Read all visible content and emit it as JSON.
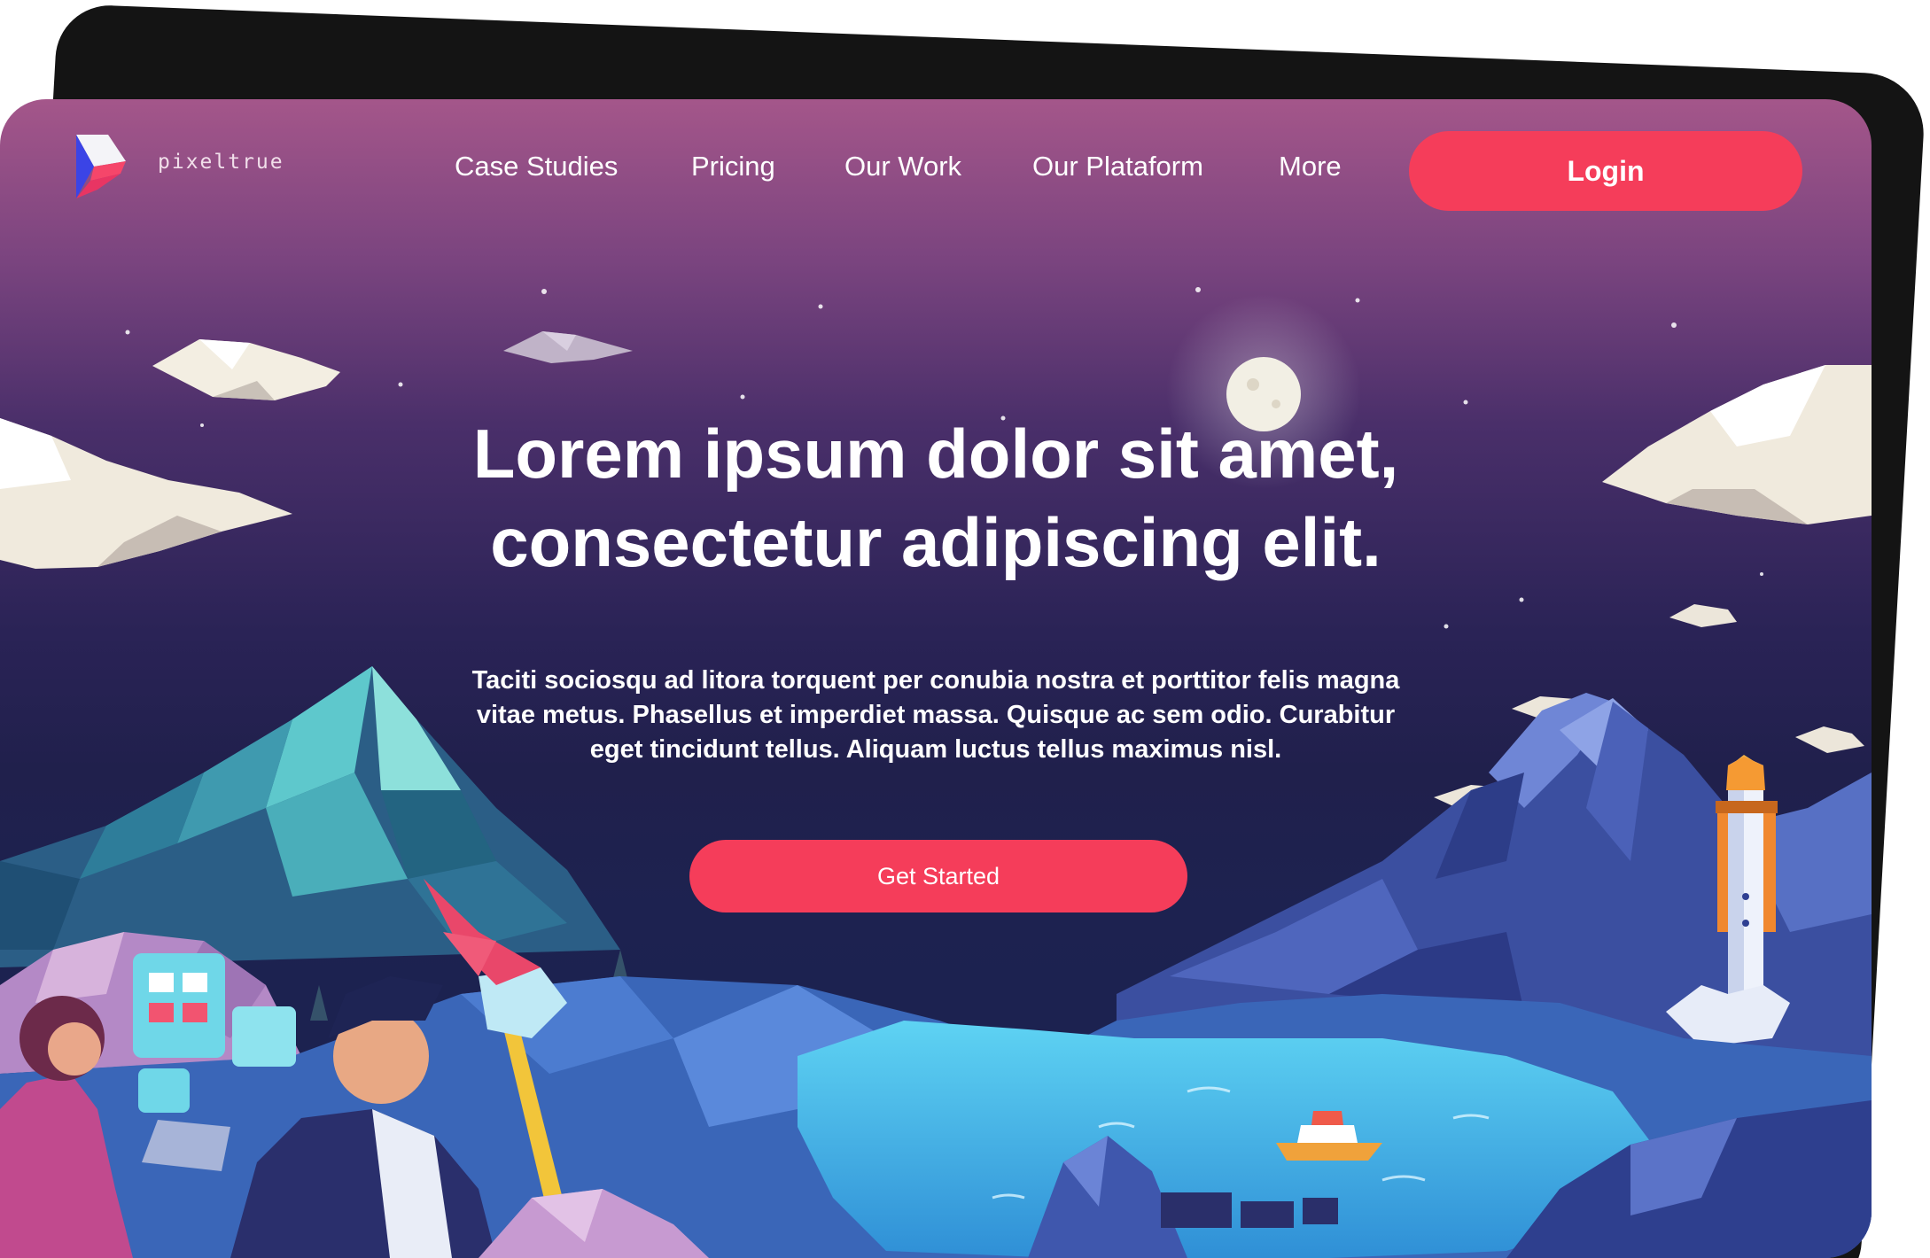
{
  "brand": {
    "name": "pixeltrue"
  },
  "nav": {
    "links": [
      "Case Studies",
      "Pricing",
      "Our Work",
      "Our Plataform",
      "More"
    ],
    "login_label": "Login"
  },
  "hero": {
    "title_line1": "Lorem ipsum dolor sit amet,",
    "title_line2": "consectetur adipiscing elit.",
    "desc_line1": "Taciti sociosqu ad litora torquent per conubia nostra et porttitor felis magna",
    "desc_line2": "vitae metus. Phasellus et imperdiet massa. Quisque ac sem odio. Curabitur",
    "desc_line3": "eget tincidunt tellus. Aliquam luctus tellus maximus nisl.",
    "cta_label": "Get Started"
  },
  "colors": {
    "accent": "#f53d5a",
    "sky_top": "#a4568a",
    "sky_bottom": "#1a2150",
    "water": "#4bc3ec",
    "back_card": "#141414"
  }
}
